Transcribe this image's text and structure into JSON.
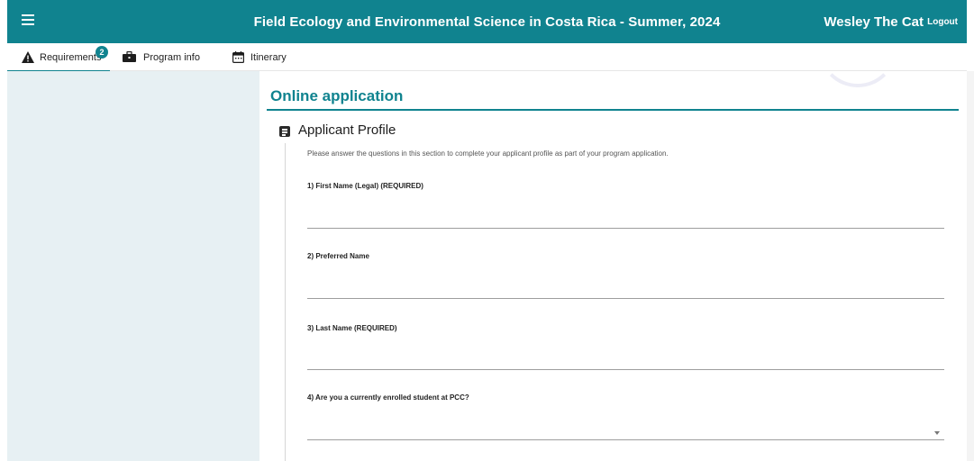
{
  "header": {
    "title": "Field Ecology and Environmental Science in Costa Rica - Summer, 2024",
    "user_name": "Wesley The Cat",
    "logout_label": "Logout",
    "menu_icon": "hamburger-menu-icon"
  },
  "tabs": [
    {
      "label": "Requirements",
      "icon": "warning-triangle-icon",
      "badge": "2",
      "active": true
    },
    {
      "label": "Program info",
      "icon": "briefcase-icon"
    },
    {
      "label": "Itinerary",
      "icon": "calendar-icon"
    }
  ],
  "main": {
    "heading": "Online application",
    "section": {
      "title": "Applicant Profile",
      "icon": "form-document-icon",
      "intro": "Please answer the questions in this section to complete your applicant profile as part of your program application."
    },
    "questions": [
      {
        "label": "1) First Name (Legal)  (REQUIRED)",
        "value": "",
        "type": "text"
      },
      {
        "label": "2) Preferred Name",
        "value": "",
        "type": "text"
      },
      {
        "label": "3) Last Name  (REQUIRED)",
        "value": "",
        "type": "text"
      },
      {
        "label": "4) Are you a currently enrolled student at PCC?",
        "value": "",
        "type": "select"
      }
    ]
  },
  "colors": {
    "accent": "#10838f",
    "sidebar_bg": "#e7f0f3"
  }
}
